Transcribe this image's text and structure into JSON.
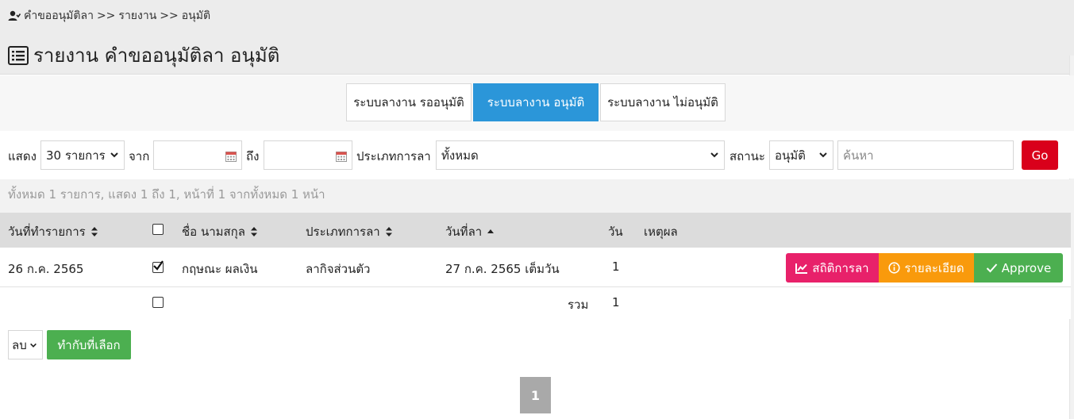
{
  "breadcrumb": {
    "items": [
      "คำขออนุมัติลา",
      "รายงาน",
      "อนุมัติ"
    ],
    "separator": ">>"
  },
  "page_title": "รายงาน คำขออนุมัติลา อนุมัติ",
  "tabs": [
    {
      "label": "ระบบลางาน รออนุมัติ",
      "active": false
    },
    {
      "label": "ระบบลางาน อนุมัติ",
      "active": true
    },
    {
      "label": "ระบบลางาน ไม่อนุมัติ",
      "active": false
    }
  ],
  "filters": {
    "show_label": "แสดง",
    "show_value": "30 รายการ",
    "from_label": "จาก",
    "from_value": "",
    "to_label": "ถึง",
    "to_value": "",
    "type_label": "ประเภทการลา",
    "type_value": "ทั้งหมด",
    "status_label": "สถานะ",
    "status_value": "อนุมัติ",
    "search_placeholder": "ค้นหา",
    "go_label": "Go"
  },
  "summary": "ทั้งหมด 1 รายการ, แสดง 1 ถึง 1, หน้าที่ 1 จากทั้งหมด 1 หน้า",
  "table": {
    "headers": {
      "created": "วันที่ทำรายการ",
      "name": "ชื่อ นามสกุล",
      "type": "ประเภทการลา",
      "leave_date": "วันที่ลา",
      "days": "วัน",
      "reason": "เหตุผล"
    },
    "rows": [
      {
        "created": "26 ก.ค. 2565",
        "checked": true,
        "name": "กฤษณะ ผลเงิน",
        "type": "ลากิจส่วนตัว",
        "leave_date": "27 ก.ค. 2565 เต็มวัน",
        "days": "1",
        "reason": ""
      }
    ],
    "total_label": "รวม",
    "total_value": "1"
  },
  "row_actions": {
    "stats_label": "สถิติการลา",
    "detail_label": "รายละเอียด",
    "approve_label": "Approve"
  },
  "bulk": {
    "action_value": "ลบ",
    "apply_label": "ทำกับที่เลือก"
  },
  "pagination": {
    "current": "1"
  },
  "colors": {
    "active_tab": "#2b96d9",
    "go": "#d9001b",
    "stats": "#e8216a",
    "detail": "#f99a0c",
    "approve": "#4caf50"
  }
}
